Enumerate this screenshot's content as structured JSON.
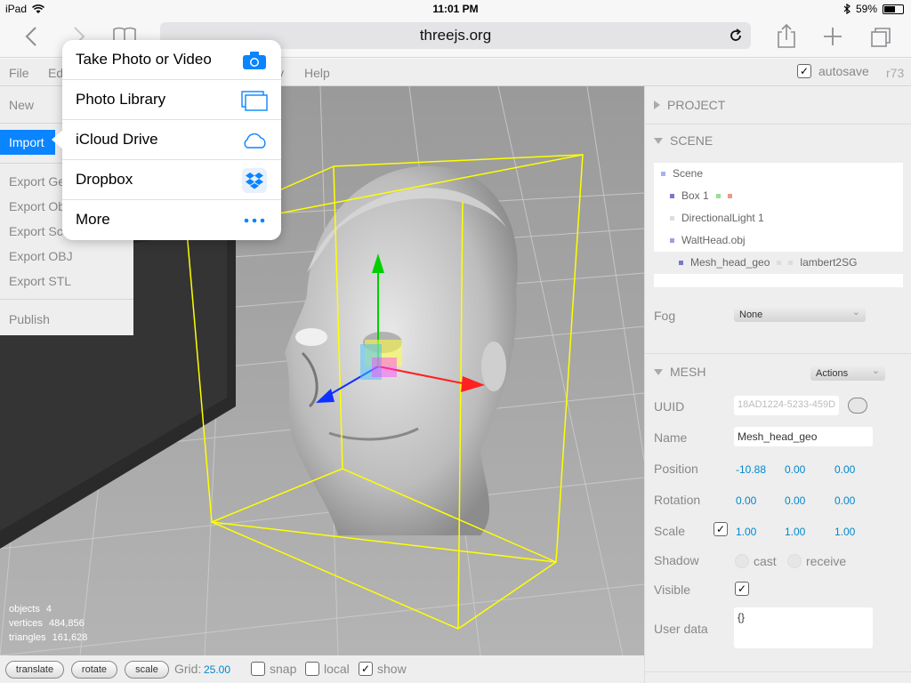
{
  "status": {
    "device": "iPad",
    "time": "11:01 PM",
    "battery": "59%",
    "battery_level": 0.59
  },
  "safari": {
    "url": "threejs.org"
  },
  "menubar": {
    "items": [
      "File",
      "Ed",
      "y",
      "Help"
    ],
    "autosave_label": "autosave",
    "revision": "r73"
  },
  "file_menu": {
    "items": [
      "New",
      "Import",
      "Export Ge",
      "Export Ob",
      "Export Sc",
      "Export OBJ",
      "Export STL",
      "Publish"
    ]
  },
  "popover": {
    "items": [
      {
        "label": "Take Photo or Video",
        "icon": "camera-icon"
      },
      {
        "label": "Photo Library",
        "icon": "photo-library-icon"
      },
      {
        "label": "iCloud Drive",
        "icon": "icloud-icon"
      },
      {
        "label": "Dropbox",
        "icon": "dropbox-icon"
      },
      {
        "label": "More",
        "icon": "more-icon"
      }
    ]
  },
  "viewport_info": {
    "objects_label": "objects",
    "objects": "4",
    "vertices_label": "vertices",
    "vertices": "484,856",
    "triangles_label": "triangles",
    "triangles": "161,628"
  },
  "sidebar": {
    "project_label": "PROJECT",
    "scene_label": "SCENE",
    "outliner": [
      "Scene",
      "Box 1",
      "DirectionalLight 1",
      "WaltHead.obj",
      "Mesh_head_geo",
      "lambert2SG"
    ],
    "fog_label": "Fog",
    "fog_value": "None",
    "mesh_label": "MESH",
    "actions_label": "Actions",
    "uuid_label": "UUID",
    "uuid_value": "18AD1224-5233-459D",
    "name_label": "Name",
    "name_value": "Mesh_head_geo",
    "position_label": "Position",
    "position": [
      "-10.88",
      "0.00",
      "0.00"
    ],
    "rotation_label": "Rotation",
    "rotation": [
      "0.00",
      "0.00",
      "0.00"
    ],
    "scale_label": "Scale",
    "scale": [
      "1.00",
      "1.00",
      "1.00"
    ],
    "shadow_label": "Shadow",
    "cast_label": "cast",
    "receive_label": "receive",
    "visible_label": "Visible",
    "userdata_label": "User data",
    "userdata_value": "{}"
  },
  "bottombar": {
    "translate": "translate",
    "rotate": "rotate",
    "scale": "scale",
    "grid_label": "Grid:",
    "grid_value": "25.00",
    "snap": "snap",
    "local": "local",
    "show": "show"
  },
  "colors": {
    "accent": "#0a84ff",
    "link": "#0088cc",
    "selection_box": "#ffff00"
  }
}
